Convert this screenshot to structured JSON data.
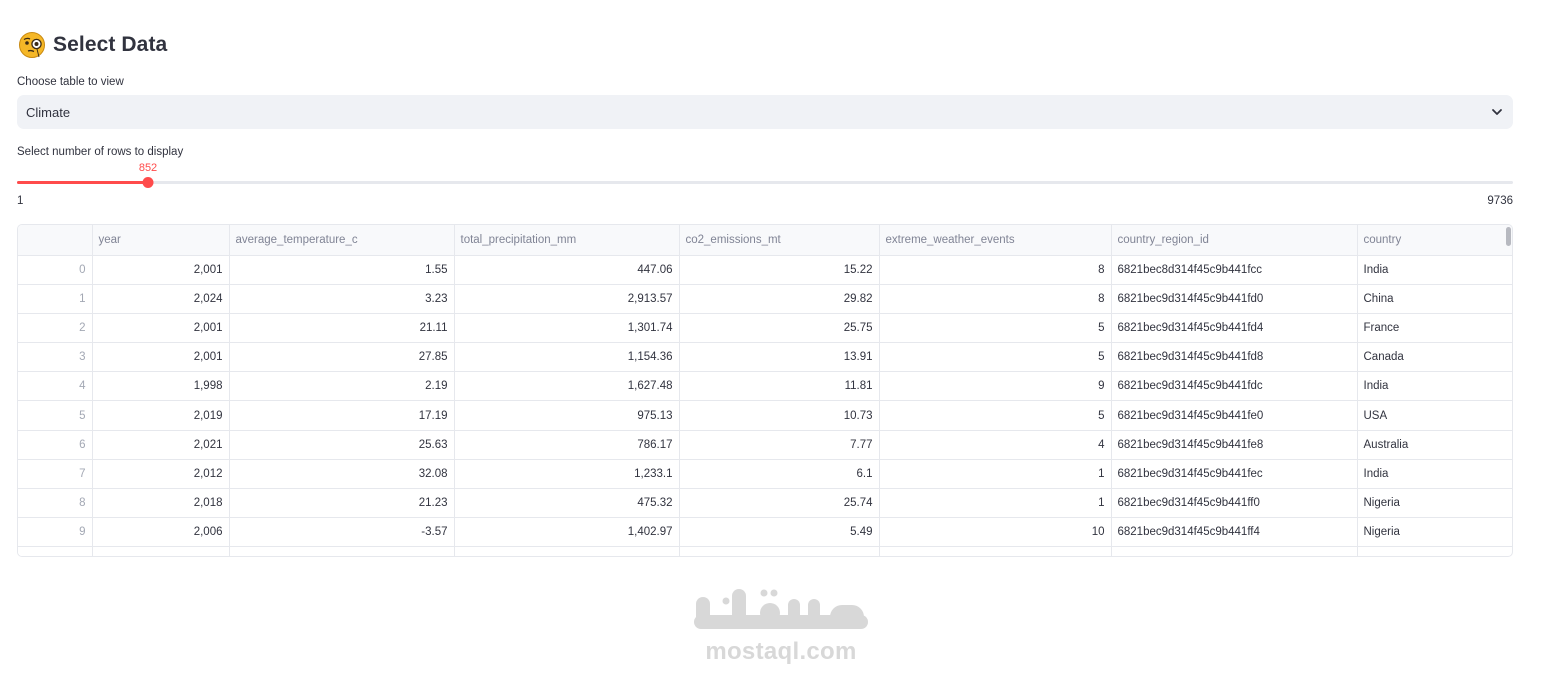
{
  "header": {
    "title": "Select Data",
    "icon": "face-with-monocle-icon"
  },
  "table_select": {
    "label": "Choose table to view",
    "value": "Climate"
  },
  "rows_slider": {
    "label": "Select number of rows to display",
    "value": 852,
    "value_text": "852",
    "min": 1,
    "min_text": "1",
    "max": 9736,
    "max_text": "9736",
    "accent": "#ff4b4b"
  },
  "table": {
    "columns": [
      "",
      "year",
      "average_temperature_c",
      "total_precipitation_mm",
      "co2_emissions_mt",
      "extreme_weather_events",
      "country_region_id",
      "country"
    ],
    "rows": [
      [
        "0",
        "2,001",
        "1.55",
        "447.06",
        "15.22",
        "8",
        "6821bec8d314f45c9b441fcc",
        "India"
      ],
      [
        "1",
        "2,024",
        "3.23",
        "2,913.57",
        "29.82",
        "8",
        "6821bec9d314f45c9b441fd0",
        "China"
      ],
      [
        "2",
        "2,001",
        "21.11",
        "1,301.74",
        "25.75",
        "5",
        "6821bec9d314f45c9b441fd4",
        "France"
      ],
      [
        "3",
        "2,001",
        "27.85",
        "1,154.36",
        "13.91",
        "5",
        "6821bec9d314f45c9b441fd8",
        "Canada"
      ],
      [
        "4",
        "1,998",
        "2.19",
        "1,627.48",
        "11.81",
        "9",
        "6821bec9d314f45c9b441fdc",
        "India"
      ],
      [
        "5",
        "2,019",
        "17.19",
        "975.13",
        "10.73",
        "5",
        "6821bec9d314f45c9b441fe0",
        "USA"
      ],
      [
        "6",
        "2,021",
        "25.63",
        "786.17",
        "7.77",
        "4",
        "6821bec9d314f45c9b441fe8",
        "Australia"
      ],
      [
        "7",
        "2,012",
        "32.08",
        "1,233.1",
        "6.1",
        "1",
        "6821bec9d314f45c9b441fec",
        "India"
      ],
      [
        "8",
        "2,018",
        "21.23",
        "475.32",
        "25.74",
        "1",
        "6821bec9d314f45c9b441ff0",
        "Nigeria"
      ],
      [
        "9",
        "2,006",
        "-3.57",
        "1,402.97",
        "5.49",
        "10",
        "6821bec9d314f45c9b441ff4",
        "Nigeria"
      ],
      [
        "",
        "",
        "",
        "",
        "",
        "",
        "",
        ""
      ]
    ]
  },
  "watermark": {
    "text": "mostaql.com",
    "logo": "مستقل"
  }
}
